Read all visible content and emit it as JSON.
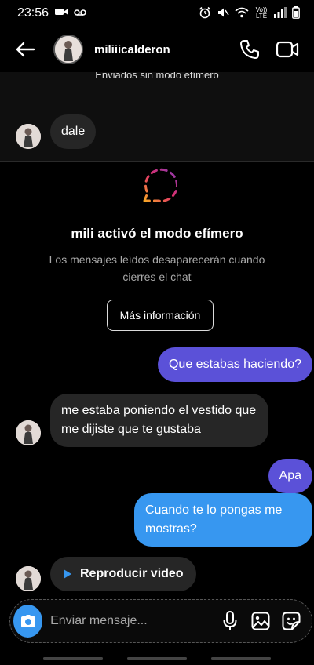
{
  "status_bar": {
    "time": "23:56",
    "network_label": "Vo)) LTE"
  },
  "header": {
    "username": "miliiicalderon"
  },
  "previous": {
    "note": "Enviados sin modo efímero",
    "message": "dale"
  },
  "ephemeral": {
    "title": "mili activó el modo efímero",
    "description": "Los mensajes leídos desaparecerán cuando cierres el chat",
    "more_info_label": "Más información"
  },
  "messages": [
    {
      "from": "me",
      "text": "Que estabas haciendo?"
    },
    {
      "from": "them",
      "text": "me estaba poniendo el vestido que me dijiste que te gustaba"
    },
    {
      "from": "me",
      "text": "Apa"
    },
    {
      "from": "me",
      "text": "Cuando te lo pongas me mostras?"
    }
  ],
  "video": {
    "label": "Reproducir video"
  },
  "composer": {
    "placeholder": "Enviar mensaje..."
  },
  "colors": {
    "outgoing_purple": "#5b51d8",
    "outgoing_blue": "#3797f0",
    "incoming": "#262626",
    "background": "#000000"
  },
  "icons": [
    "video-camera-icon",
    "voicemail-icon",
    "alarm-icon",
    "mute-icon",
    "wifi-icon",
    "signal-icon",
    "battery-icon",
    "back-arrow-icon",
    "phone-icon",
    "video-call-icon",
    "ephemeral-icon",
    "play-icon",
    "camera-icon",
    "microphone-icon",
    "gallery-icon",
    "sticker-icon"
  ]
}
